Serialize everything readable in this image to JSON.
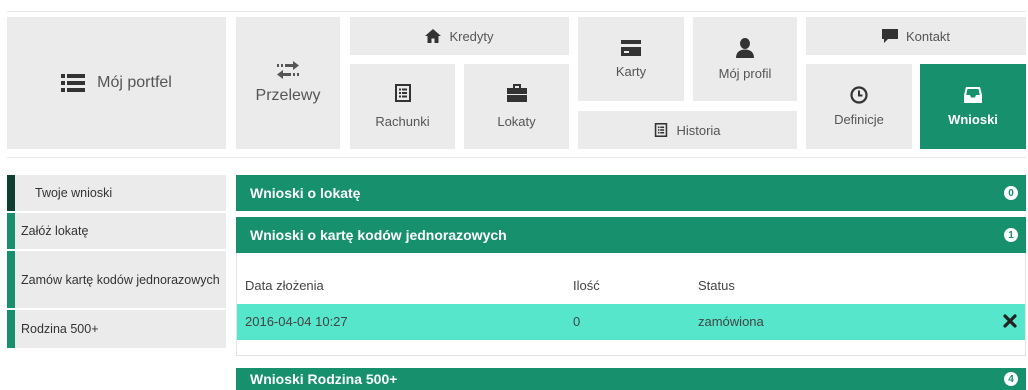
{
  "nav": {
    "portfel": "Mój portfel",
    "przelewy": "Przelewy",
    "kredyty": "Kredyty",
    "rachunki": "Rachunki",
    "lokaty": "Lokaty",
    "karty": "Karty",
    "profil": "Mój profil",
    "historia": "Historia",
    "kontakt": "Kontakt",
    "definicje": "Definicje",
    "wnioski": "Wnioski",
    "icons": {
      "portfel": "list-icon",
      "przelewy": "transfer-arrows-icon",
      "kredyty": "home-icon",
      "rachunki": "document-list-icon",
      "lokaty": "briefcase-icon",
      "karty": "credit-card-icon",
      "profil": "user-icon",
      "historia": "document-list-icon",
      "kontakt": "chat-bubble-icon",
      "definicje": "clock-icon",
      "wnioski": "inbox-icon"
    }
  },
  "sidebar": {
    "items": [
      {
        "label": "Twoje wnioski",
        "active": true
      },
      {
        "label": "Załóż lokatę",
        "active": false
      },
      {
        "label": "Zamów kartę kodów jednorazowych",
        "active": false
      },
      {
        "label": "Rodzina 500+",
        "active": false
      }
    ]
  },
  "panels": [
    {
      "title": "Wnioski o lokatę",
      "count": "0"
    },
    {
      "title": "Wnioski o kartę kodów jednorazowych",
      "count": "1",
      "columns": [
        "Data złożenia",
        "Ilość",
        "Status"
      ],
      "rows": [
        {
          "date": "2016-04-04 10:27",
          "qty": "0",
          "status": "zamówiona"
        }
      ]
    },
    {
      "title": "Wnioski Rodzina 500+",
      "count": "4"
    }
  ],
  "colors": {
    "accent": "#17906e",
    "active_sidebar": "#0f3f31",
    "tile_bg": "#ebebeb",
    "row_highlight": "#55e6cc"
  }
}
